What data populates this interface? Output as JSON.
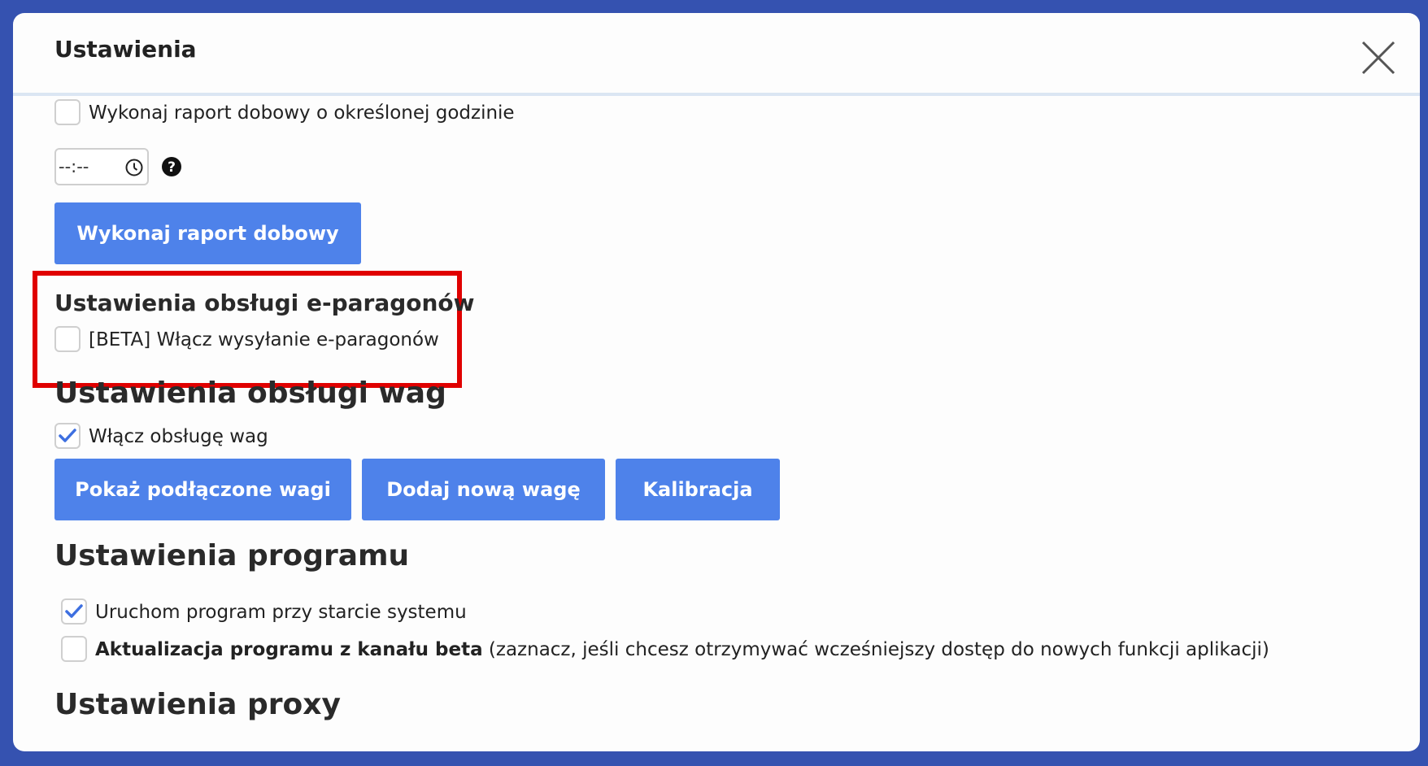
{
  "dialog": {
    "title": "Ustawienia",
    "close_icon": "close-icon"
  },
  "daily_report": {
    "checkbox_label": "Wykonaj raport dobowy o określonej godzinie",
    "checked": false,
    "time_value": "--:--",
    "clock_icon": "clock-icon",
    "help_icon": "question-circle-icon",
    "button_label": "Wykonaj raport dobowy"
  },
  "e_receipts": {
    "title": "Ustawienia obsługi e-paragonów",
    "checkbox_label": "[BETA] Włącz wysyłanie e-paragonów",
    "checked": false
  },
  "scales": {
    "title": "Ustawienia obsługi wag",
    "checkbox_label": "Włącz obsługę wag",
    "checked": true,
    "buttons": {
      "show_connected": "Pokaż podłączone wagi",
      "add_new": "Dodaj nową wagę",
      "calibration": "Kalibracja"
    }
  },
  "program": {
    "title": "Ustawienia programu",
    "autostart_label": "Uruchom program przy starcie systemu",
    "autostart_checked": true,
    "beta_channel_bold": "Aktualizacja programu z kanału beta",
    "beta_channel_note": " (zaznacz, jeśli chcesz otrzymywać wcześniejszy dostęp do nowych funkcji aplikacji)",
    "beta_channel_checked": false
  },
  "proxy": {
    "title": "Ustawienia proxy"
  },
  "colors": {
    "backdrop": "#3552b0",
    "accent": "#4e82ea",
    "highlight": "#e00000",
    "check": "#3d6fe0"
  }
}
